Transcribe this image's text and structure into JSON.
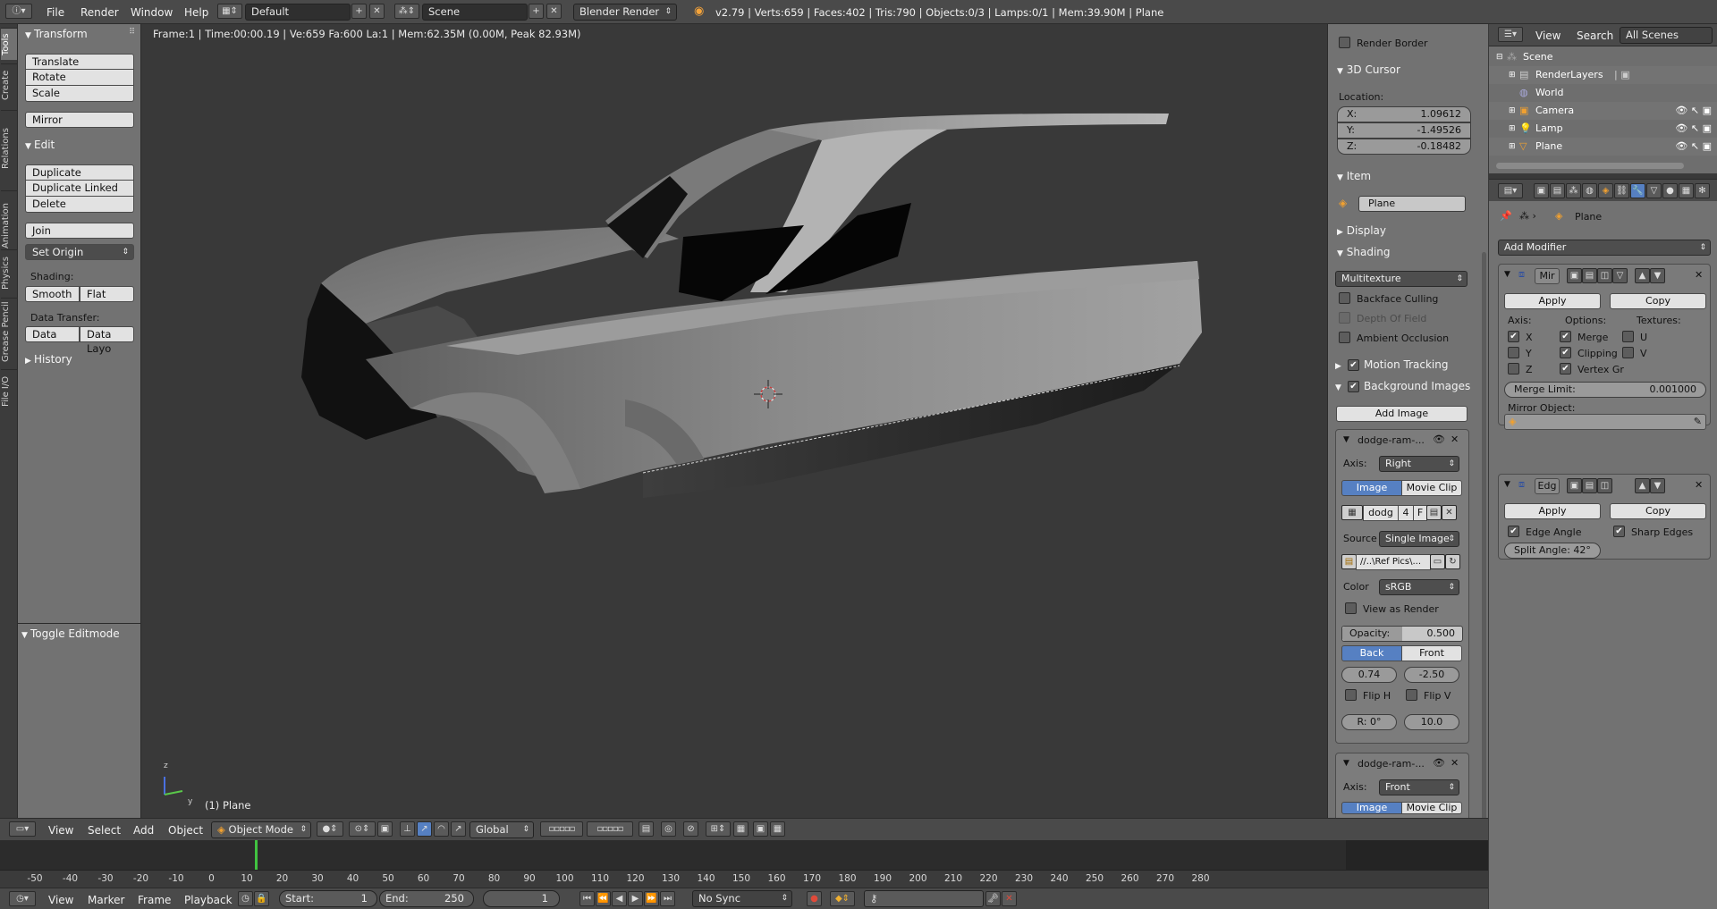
{
  "top_header": {
    "menus": [
      "File",
      "Render",
      "Window",
      "Help"
    ],
    "layout": "Default",
    "scene": "Scene",
    "engine": "Blender Render",
    "stats": "v2.79 | Verts:659 | Faces:402 | Tris:790 | Objects:0/3 | Lamps:0/1 | Mem:39.90M | Plane"
  },
  "tabs": [
    "Tools",
    "Create",
    "Relations",
    "Animation",
    "Physics",
    "Grease Pencil",
    "File I/O"
  ],
  "tool_shelf": {
    "transform_title": "Transform",
    "transform_buttons": [
      "Translate",
      "Rotate",
      "Scale",
      "Mirror"
    ],
    "edit_title": "Edit",
    "edit_buttons": [
      "Duplicate",
      "Duplicate Linked",
      "Delete",
      "Join"
    ],
    "set_origin": "Set Origin",
    "shading_label": "Shading:",
    "smooth": "Smooth",
    "flat": "Flat",
    "data_transfer_label": "Data Transfer:",
    "data": "Data",
    "data_layo": "Data Layo",
    "history_title": "History",
    "toggle_editmode": "Toggle Editmode"
  },
  "viewport": {
    "info": "Frame:1 | Time:00:00.19 | Ve:659 Fa:600 La:1 | Mem:62.35M (0.00M, Peak 82.93M)",
    "object_name": "(1) Plane",
    "axis_y": "y",
    "axis_z": "z"
  },
  "vp_header": {
    "menus": [
      "View",
      "Select",
      "Add",
      "Object"
    ],
    "mode": "Object Mode",
    "orientation": "Global"
  },
  "timeline": {
    "ticks": [
      -50,
      -40,
      -30,
      -20,
      -10,
      0,
      10,
      20,
      30,
      40,
      50,
      60,
      70,
      80,
      90,
      100,
      110,
      120,
      130,
      140,
      150,
      160,
      170,
      180,
      190,
      200,
      210,
      220,
      230,
      240,
      250,
      260,
      270,
      280
    ],
    "menus": [
      "View",
      "Marker",
      "Frame",
      "Playback"
    ],
    "start_label": "Start:",
    "start": "1",
    "end_label": "End:",
    "end": "250",
    "current": "1",
    "sync": "No Sync"
  },
  "n_panel": {
    "render_border": "Render Border",
    "cursor_title": "3D Cursor",
    "location_label": "Location:",
    "x_label": "X:",
    "x": "1.09612",
    "y_label": "Y:",
    "y": "-1.49526",
    "z_label": "Z:",
    "z": "-0.18482",
    "item_title": "Item",
    "item_name": "Plane",
    "display_title": "Display",
    "shading_title": "Shading",
    "shading_mode": "Multitexture",
    "backface": "Backface Culling",
    "dof": "Depth Of Field",
    "ao": "Ambient Occlusion",
    "motion_tracking": "Motion Tracking",
    "bg_images": "Background Images",
    "add_image": "Add Image",
    "bg1": {
      "name": "dodge-ram-...",
      "axis_label": "Axis:",
      "axis": "Right",
      "image": "Image",
      "movie_clip": "Movie Clip",
      "img_name": "dodg",
      "users": "4",
      "f": "F",
      "source_label": "Source",
      "source": "Single Image",
      "path": "//..\\Ref Pics\\...",
      "color_label": "Color",
      "color": "sRGB",
      "view_as_render": "View as Render",
      "opacity_label": "Opacity:",
      "opacity": "0.500",
      "opacity_value": 0.5,
      "back": "Back",
      "front": "Front",
      "offset_x": "0.74",
      "offset_y": "-2.50",
      "flip_h": "Flip H",
      "flip_v": "Flip V",
      "rotation": "R: 0°",
      "size": "10.0"
    },
    "bg2": {
      "name": "dodge-ram-...",
      "axis_label": "Axis:",
      "axis": "Front",
      "image": "Image",
      "movie_clip": "Movie Clip"
    }
  },
  "outliner": {
    "menus": [
      "View",
      "Search"
    ],
    "scope": "All Scenes",
    "rows": [
      "Scene",
      "RenderLayers",
      "World",
      "Camera",
      "Lamp",
      "Plane"
    ]
  },
  "properties": {
    "breadcrumb": "Plane",
    "add_modifier": "Add Modifier",
    "mod1": {
      "name": "Mir",
      "apply": "Apply",
      "copy": "Copy",
      "axis_label": "Axis:",
      "options_label": "Options:",
      "textures_label": "Textures:",
      "x": "X",
      "y": "Y",
      "z": "Z",
      "merge": "Merge",
      "clipping": "Clipping",
      "vertex_gr": "Vertex Gr",
      "u": "U",
      "v": "V",
      "merge_limit_label": "Merge Limit:",
      "merge_limit": "0.001000",
      "mirror_object_label": "Mirror Object:"
    },
    "mod2": {
      "name": "Edg",
      "apply": "Apply",
      "copy": "Copy",
      "edge_angle": "Edge Angle",
      "sharp_edges": "Sharp Edges",
      "split_angle": "Split Angle: 42°"
    }
  },
  "colors": {
    "accent_blue": "#5680c2",
    "timeline_cursor": "#41c341",
    "background": "#393939"
  }
}
